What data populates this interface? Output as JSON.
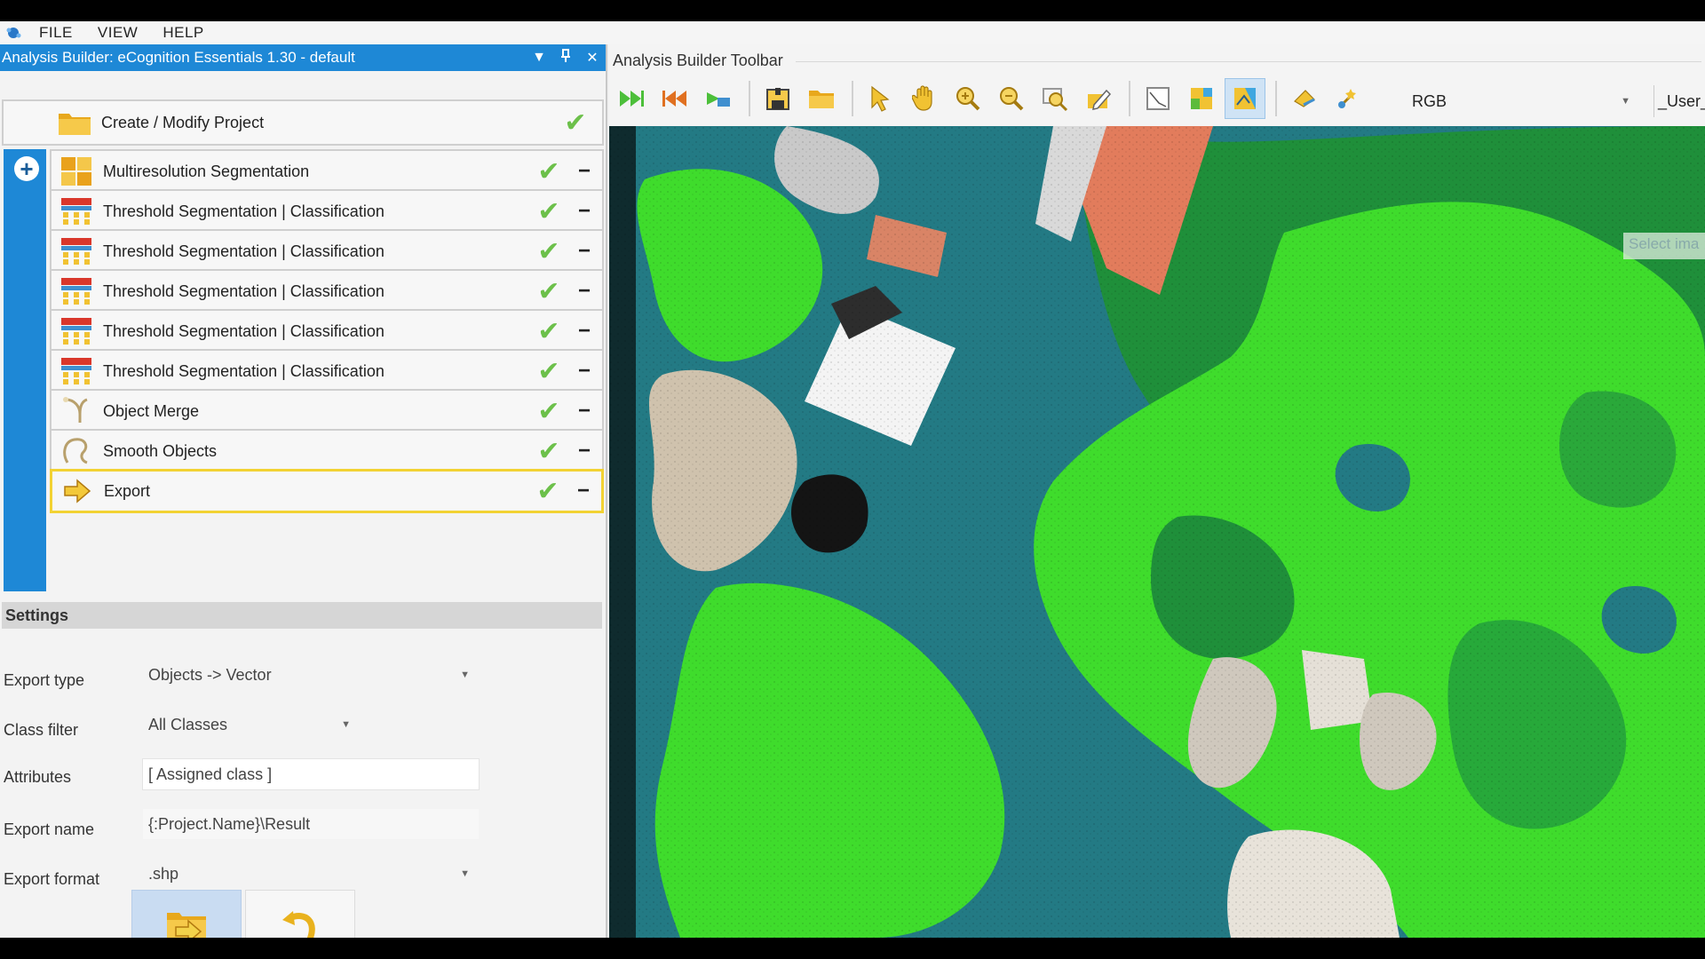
{
  "menubar": {
    "items": [
      "FILE",
      "VIEW",
      "HELP"
    ]
  },
  "panel": {
    "title": "Analysis Builder: eCognition Essentials 1.30 - default",
    "create_step": "Create / Modify Project",
    "steps": [
      {
        "label": "Multiresolution Segmentation",
        "icon": "segmentation-icon"
      },
      {
        "label": "Threshold Segmentation | Classification",
        "icon": "threshold-icon"
      },
      {
        "label": "Threshold Segmentation | Classification",
        "icon": "threshold-icon"
      },
      {
        "label": "Threshold Segmentation | Classification",
        "icon": "threshold-icon"
      },
      {
        "label": "Threshold Segmentation | Classification",
        "icon": "threshold-icon"
      },
      {
        "label": "Threshold Segmentation | Classification",
        "icon": "threshold-icon"
      },
      {
        "label": "Object Merge",
        "icon": "merge-icon"
      },
      {
        "label": "Smooth Objects",
        "icon": "smooth-icon"
      },
      {
        "label": "Export",
        "icon": "export-icon",
        "selected": true
      }
    ]
  },
  "settings": {
    "header": "Settings",
    "export_type": {
      "label": "Export type",
      "value": "Objects -> Vector"
    },
    "class_filter": {
      "label": "Class filter",
      "value": "All Classes"
    },
    "attributes": {
      "label": "Attributes",
      "value": "[ Assigned class ]"
    },
    "export_name": {
      "label": "Export name",
      "value": "{:Project.Name}\\Result"
    },
    "export_format": {
      "label": "Export format",
      "value": ".shp"
    }
  },
  "toolbar": {
    "title": "Analysis Builder Toolbar",
    "image_layer_select": "RGB",
    "user_field": "_User_",
    "tooltip": "Select ima"
  },
  "colors": {
    "accent": "#1e88d6",
    "selected_border": "#f2d233",
    "check": "#6cc04a",
    "vegetation_bright": "#3fdc2c",
    "vegetation_dark": "#1f8f3a",
    "water_teal": "#237a84"
  }
}
